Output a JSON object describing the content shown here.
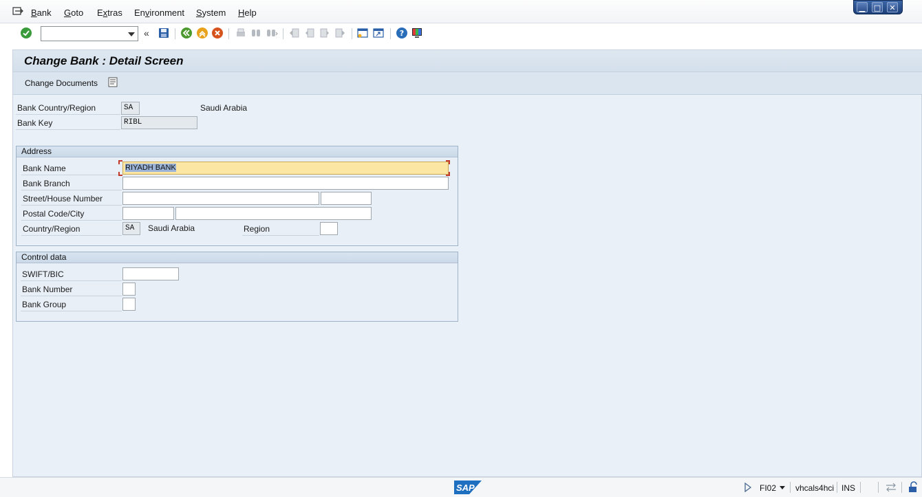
{
  "menu": {
    "items": [
      {
        "label": "Bank",
        "key": "B"
      },
      {
        "label": "Goto",
        "key": "G"
      },
      {
        "label": "Extras",
        "key": "x"
      },
      {
        "label": "Environment",
        "key": "v"
      },
      {
        "label": "System",
        "key": "S"
      },
      {
        "label": "Help",
        "key": "H"
      }
    ]
  },
  "window_controls": [
    "minimize-icon",
    "maximize-icon",
    "close-icon"
  ],
  "toolbar": {
    "command_field_value": "",
    "icons": [
      "enter-icon",
      "save-icon",
      "back-icon",
      "exit-icon",
      "cancel-icon",
      "print-icon",
      "find-icon",
      "find-next-icon",
      "first-page-icon",
      "previous-page-icon",
      "next-page-icon",
      "last-page-icon",
      "create-session-icon",
      "shortcut-icon",
      "help-icon",
      "customize-layout-icon"
    ]
  },
  "title": "Change Bank : Detail Screen",
  "app_toolbar": {
    "change_documents_label": "Change Documents"
  },
  "header_fields": {
    "bank_country_label": "Bank Country/Region",
    "bank_country_value": "SA",
    "bank_country_text": "Saudi Arabia",
    "bank_key_label": "Bank Key",
    "bank_key_value": "RIBL"
  },
  "address": {
    "title": "Address",
    "bank_name_label": "Bank Name",
    "bank_name_value": "RIYADH BANK",
    "bank_branch_label": "Bank Branch",
    "bank_branch_value": "",
    "street_label": "Street/House Number",
    "street_value": "",
    "house_number_value": "",
    "postal_label": "Postal Code/City",
    "postal_value": "",
    "city_value": "",
    "country_label": "Country/Region",
    "country_value": "SA",
    "country_text": "Saudi Arabia",
    "region_label": "Region",
    "region_value": ""
  },
  "control_data": {
    "title": "Control data",
    "swift_label": "SWIFT/BIC",
    "swift_value": "",
    "bank_number_label": "Bank Number",
    "bank_number_value": "",
    "bank_group_label": "Bank Group",
    "bank_group_value": ""
  },
  "statusbar": {
    "logo_text": "SAP",
    "transaction": "FI02",
    "server": "vhcals4hci",
    "mode": "INS"
  },
  "colors": {
    "panel_bg": "#e9f0f7",
    "focus_field_bg": "#fbe7a3",
    "sap_blue": "#1f6fc1",
    "enter_green": "#3a9b3a"
  }
}
